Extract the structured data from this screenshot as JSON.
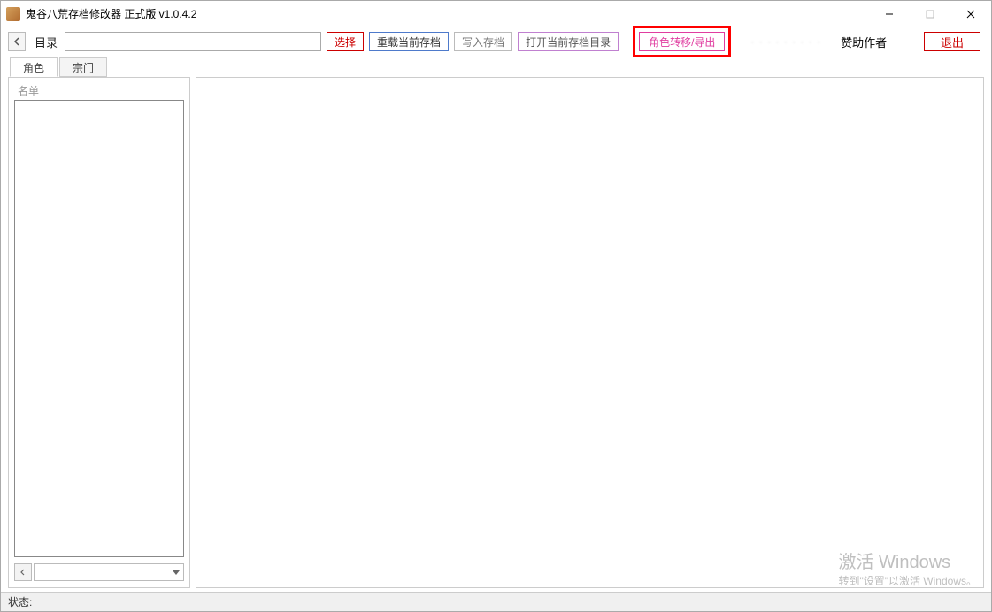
{
  "window": {
    "title": "鬼谷八荒存档修改器 正式版 v1.0.4.2"
  },
  "toolbar": {
    "dir_label": "目录",
    "dir_value": "",
    "select": "选择",
    "reload": "重载当前存档",
    "write": "写入存档",
    "open_dir": "打开当前存档目录",
    "transfer": "角色转移/导出",
    "blur_placeholder": "· · · · · · · · ·",
    "sponsor": "赞助作者",
    "exit": "退出"
  },
  "tabs": {
    "role": "角色",
    "sect": "宗门"
  },
  "left": {
    "list_label": "名单",
    "combo_value": ""
  },
  "status": {
    "label": "状态:"
  },
  "watermark": {
    "big": "激活 Windows",
    "small": "转到\"设置\"以激活 Windows。"
  }
}
